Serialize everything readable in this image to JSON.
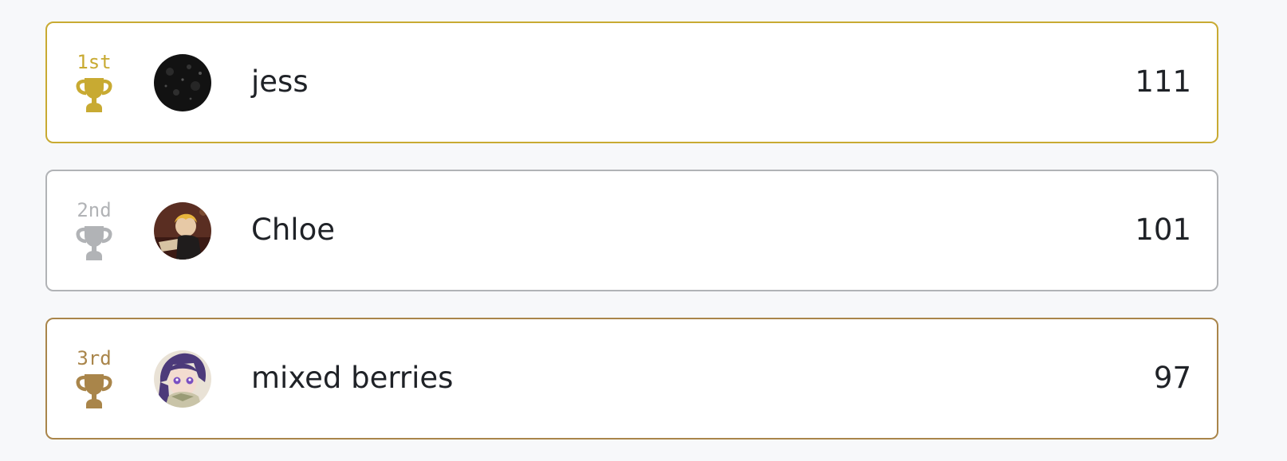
{
  "leaderboard": {
    "entries": [
      {
        "rank_label": "1st",
        "username": "jess",
        "score": "111",
        "color": "#c8aa32",
        "trophy_icon": "trophy-gold-icon",
        "avatar_icon": "dark-starry-avatar"
      },
      {
        "rank_label": "2nd",
        "username": "Chloe",
        "score": "101",
        "color": "#b1b3b6",
        "trophy_icon": "trophy-silver-icon",
        "avatar_icon": "anime-character-reading-avatar"
      },
      {
        "rank_label": "3rd",
        "username": "mixed berries",
        "score": "97",
        "color": "#a9854a",
        "trophy_icon": "trophy-bronze-icon",
        "avatar_icon": "anime-purple-hair-avatar"
      }
    ]
  }
}
